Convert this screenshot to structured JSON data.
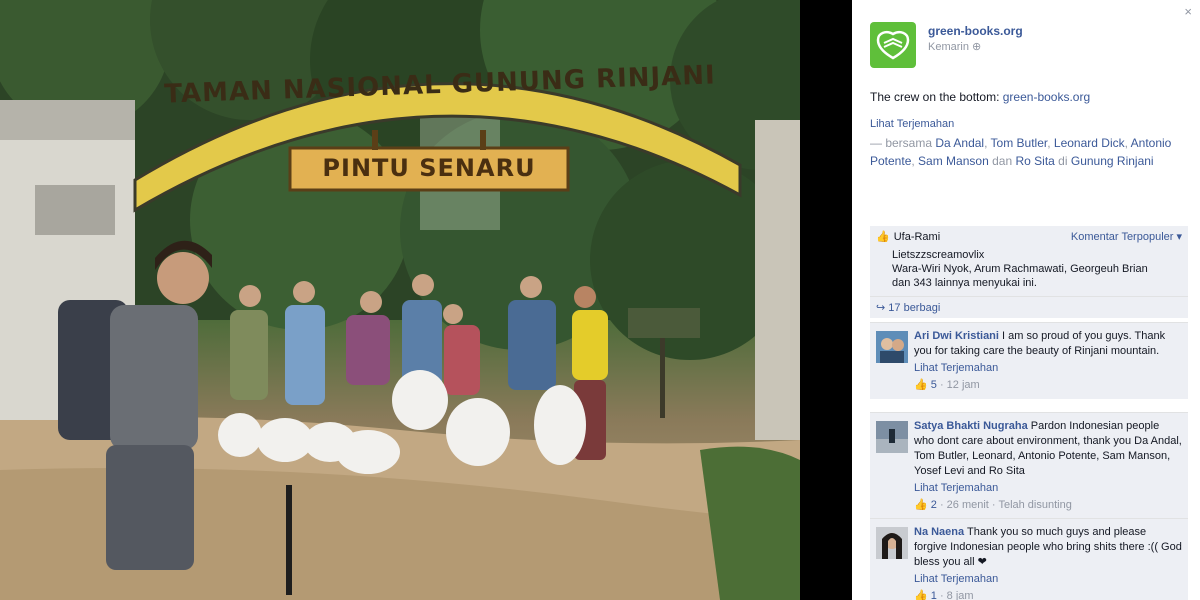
{
  "photo": {
    "arch_text": "TAMAN NASIONAL GUNUNG RINJANI",
    "sign_text": "PINTU SENARU"
  },
  "panel": {
    "close_label": "×",
    "page_name": "green-books.org",
    "post_date": "Kemarin",
    "caption_text": "The crew on the bottom:",
    "caption_link": "green-books.org",
    "see_translation": "Lihat Terjemahan",
    "tags": {
      "prefix": "— bersama",
      "people": [
        "Da Andal",
        "Tom Butler",
        "Leonard Dick",
        "Antonio Potente",
        "Sam Manson",
        "Ro Sita"
      ],
      "joiner": "dan",
      "location_prefix": "di",
      "location": "Gunung Rinjani"
    },
    "likes": {
      "first_name": "Ufa-Rami",
      "popular_label": "Komentar Terpopuler ▾",
      "line2": "Lietszzscreamovlix",
      "line3": "Wara-Wiri Nyok, Arum Rachmawati, Georgeuh Brian",
      "line4": "dan 343 lainnya menyukai ini."
    },
    "shares": "17 berbagi",
    "comments": [
      {
        "author": "Ari Dwi Kristiani",
        "text": "I am so proud of you guys. Thank you for taking care the beauty of Rinjani mountain.",
        "translate": "Lihat Terjemahan",
        "likes": "5",
        "time": "12 jam",
        "edited": ""
      },
      {
        "author": "Satya Bhakti Nugraha",
        "text": "Pardon Indonesian people who dont care about environment, thank you Da Andal, Tom Butler, Leonard, Antonio Potente, Sam Manson, Yosef Levi and Ro Sita",
        "translate": "Lihat Terjemahan",
        "likes": "2",
        "time": "26 menit",
        "edited": "Telah disunting"
      },
      {
        "author": "Na Naena",
        "text": "Thank you so much guys and please forgive Indonesian people who bring shits there :(( God bless you all ❤",
        "translate": "Lihat Terjemahan",
        "likes": "1",
        "time": "8 jam",
        "edited": ""
      }
    ]
  },
  "colors": {
    "link": "#3b5998",
    "muted": "#9197a3",
    "logo_green": "#5fbf3a",
    "comment_bg": "#edeff4"
  },
  "icons": [
    "close-icon",
    "globe-icon",
    "thumb-up-icon",
    "share-icon",
    "logo-icon"
  ]
}
